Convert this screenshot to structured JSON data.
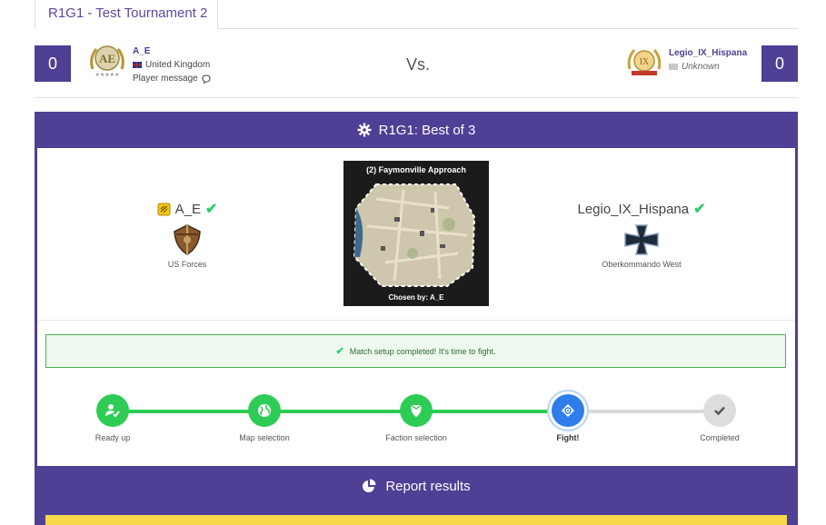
{
  "tab": {
    "label": "R1G1 - Test Tournament 2"
  },
  "header": {
    "left": {
      "score": "0",
      "name": "A_E",
      "country": "United Kingdom",
      "message_link": "Player message"
    },
    "vs": "Vs.",
    "right": {
      "score": "0",
      "name": "Legio_IX_Hispana",
      "country": "Unknown"
    }
  },
  "match": {
    "title": "R1G1: Best of 3",
    "left": {
      "name": "A_E",
      "faction": "US Forces"
    },
    "right": {
      "name": "Legio_IX_Hispana",
      "faction": "Oberkommando West"
    },
    "map": {
      "title": "(2) Faymonville Approach",
      "chosen_by": "Chosen by: A_E"
    },
    "alert": "Match setup completed! It's time to fight."
  },
  "steps": [
    {
      "label": "Ready up",
      "state": "done",
      "icon": "user-check-icon"
    },
    {
      "label": "Map selection",
      "state": "done",
      "icon": "globe-icon"
    },
    {
      "label": "Faction selection",
      "state": "done",
      "icon": "shield-icon"
    },
    {
      "label": "Fight!",
      "state": "active",
      "icon": "crosshair-icon"
    },
    {
      "label": "Completed",
      "state": "todo",
      "icon": "check-icon"
    }
  ],
  "report": {
    "title": "Report results"
  },
  "colors": {
    "brand": "#4f3f95",
    "success": "#2ecc55",
    "active": "#2e7dea",
    "warning": "#f7d84a"
  }
}
